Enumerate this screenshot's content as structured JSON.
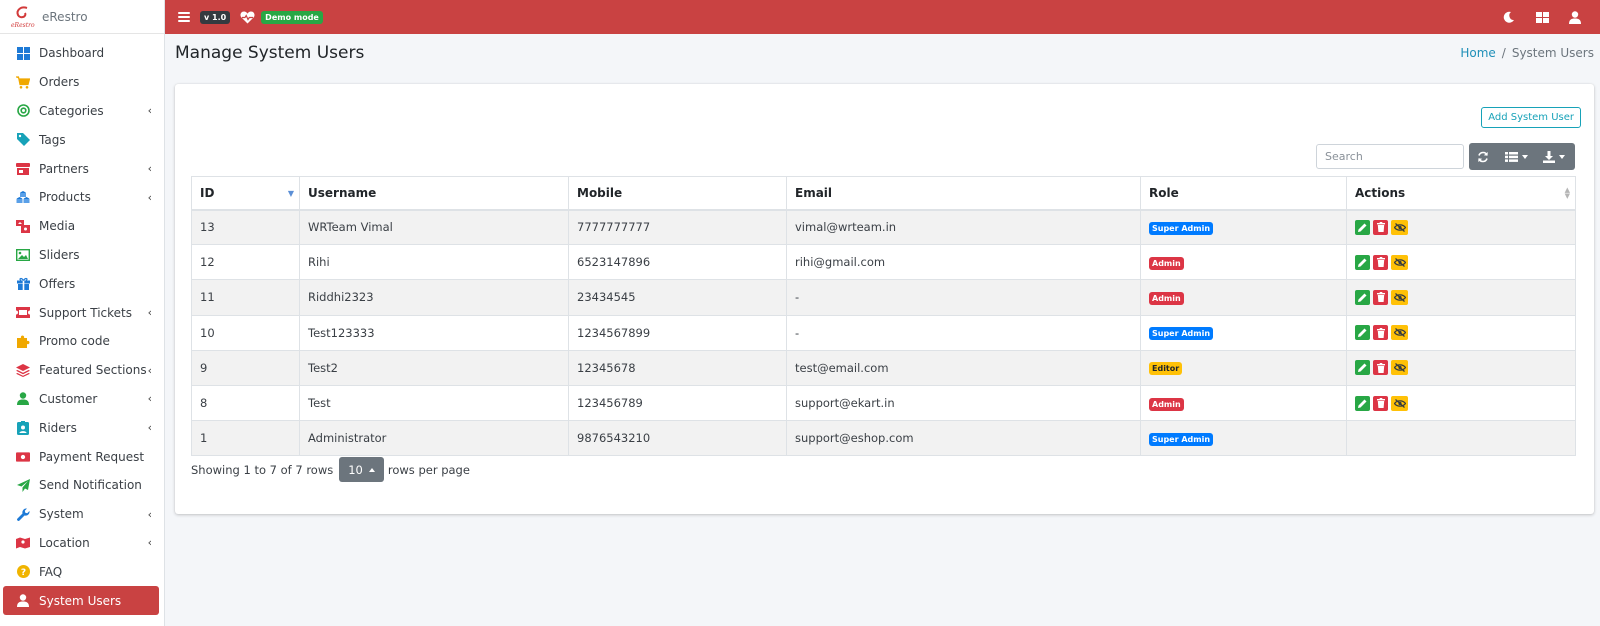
{
  "brand": {
    "name": "eRestro",
    "logo_text": "eRestro"
  },
  "topbar": {
    "version": "v 1.0",
    "demo": "Demo mode"
  },
  "sidebar": {
    "items": [
      {
        "label": "Dashboard",
        "icon": "dashboard-icon",
        "chev": ""
      },
      {
        "label": "Orders",
        "icon": "cart-icon",
        "chev": ""
      },
      {
        "label": "Categories",
        "icon": "target-icon",
        "chev": "‹"
      },
      {
        "label": "Tags",
        "icon": "tag-icon",
        "chev": ""
      },
      {
        "label": "Partners",
        "icon": "store-icon",
        "chev": "‹"
      },
      {
        "label": "Products",
        "icon": "cubes-icon",
        "chev": "‹"
      },
      {
        "label": "Media",
        "icon": "photo-video-icon",
        "chev": ""
      },
      {
        "label": "Sliders",
        "icon": "image-icon",
        "chev": ""
      },
      {
        "label": "Offers",
        "icon": "gift-icon",
        "chev": ""
      },
      {
        "label": "Support Tickets",
        "icon": "ticket-icon",
        "chev": "‹"
      },
      {
        "label": "Promo code",
        "icon": "puzzle-icon",
        "chev": ""
      },
      {
        "label": "Featured Sections",
        "icon": "layers-icon",
        "chev": "‹"
      },
      {
        "label": "Customer",
        "icon": "user-icon",
        "chev": "‹"
      },
      {
        "label": "Riders",
        "icon": "id-badge-icon",
        "chev": "‹"
      },
      {
        "label": "Payment Request",
        "icon": "money-icon",
        "chev": ""
      },
      {
        "label": "Send Notification",
        "icon": "paper-plane-icon",
        "chev": ""
      },
      {
        "label": "System",
        "icon": "wrench-icon",
        "chev": "‹"
      },
      {
        "label": "Location",
        "icon": "map-marker-icon",
        "chev": "‹"
      },
      {
        "label": "FAQ",
        "icon": "question-icon",
        "chev": ""
      },
      {
        "label": "System Users",
        "icon": "user-icon",
        "chev": ""
      }
    ]
  },
  "header": {
    "title": "Manage System Users",
    "breadcrumb_home": "Home",
    "breadcrumb_sep": "/",
    "breadcrumb_current": "System Users"
  },
  "toolbar": {
    "add_label": "Add System User",
    "search_placeholder": "Search"
  },
  "table": {
    "columns": [
      "ID",
      "Username",
      "Mobile",
      "Email",
      "Role",
      "Actions"
    ],
    "rows": [
      {
        "id": "13",
        "username": "WRTeam Vimal",
        "mobile": "7777777777",
        "email": "vimal@wrteam.in",
        "role": "Super Admin",
        "role_color": "#007bff",
        "actions": true
      },
      {
        "id": "12",
        "username": "Rihi",
        "mobile": "6523147896",
        "email": "rihi@gmail.com",
        "role": "Admin",
        "role_color": "#dc3545",
        "actions": true
      },
      {
        "id": "11",
        "username": "Riddhi2323",
        "mobile": "23434545",
        "email": "-",
        "role": "Admin",
        "role_color": "#dc3545",
        "actions": true
      },
      {
        "id": "10",
        "username": "Test123333",
        "mobile": "1234567899",
        "email": "-",
        "role": "Super Admin",
        "role_color": "#007bff",
        "actions": true
      },
      {
        "id": "9",
        "username": "Test2",
        "mobile": "12345678",
        "email": "test@email.com",
        "role": "Editor",
        "role_color": "#ffc107",
        "actions": true
      },
      {
        "id": "8",
        "username": "Test",
        "mobile": "123456789",
        "email": "support@ekart.in",
        "role": "Admin",
        "role_color": "#dc3545",
        "actions": true
      },
      {
        "id": "1",
        "username": "Administrator",
        "mobile": "9876543210",
        "email": "support@eshop.com",
        "role": "Super Admin",
        "role_color": "#007bff",
        "actions": false
      }
    ]
  },
  "pagination": {
    "showing": "Showing 1 to 7 of 7 rows",
    "page_size": "10",
    "suffix": "rows per page"
  },
  "colors": {
    "primary": "#c94242",
    "edit": "#28a745",
    "delete": "#dc3545",
    "warn": "#ffc107"
  }
}
